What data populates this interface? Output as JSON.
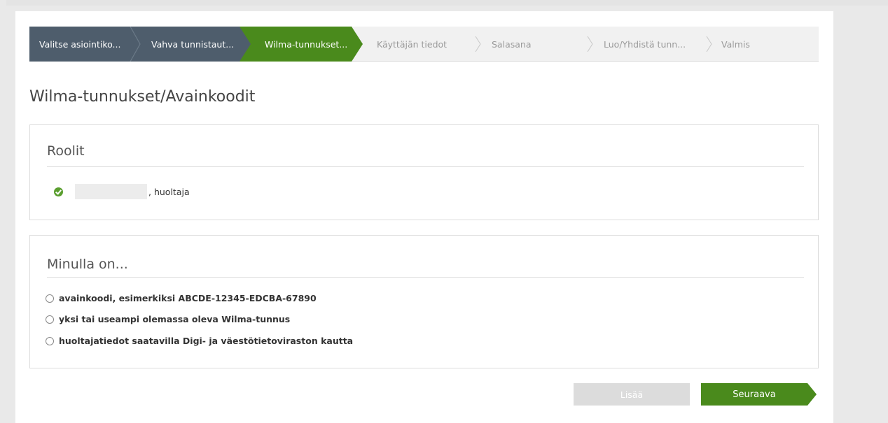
{
  "colors": {
    "step_done": "#4e5d6c",
    "step_active": "#4a8a1c",
    "primary_button": "#4a8a1c",
    "disabled_button": "#dcdcdc",
    "check_green": "#5a9e2f"
  },
  "stepper": {
    "steps": [
      {
        "label": "Valitse asiointiko...",
        "state": "done"
      },
      {
        "label": "Vahva tunnistaut...",
        "state": "done"
      },
      {
        "label": "Wilma-tunnukset...",
        "state": "active"
      },
      {
        "label": "Käyttäjän tiedot",
        "state": "todo"
      },
      {
        "label": "Salasana",
        "state": "todo"
      },
      {
        "label": "Luo/Yhdistä tunn...",
        "state": "todo"
      },
      {
        "label": "Valmis",
        "state": "todo"
      }
    ]
  },
  "page": {
    "title": "Wilma-tunnukset/Avainkoodit"
  },
  "roles_panel": {
    "title": "Roolit",
    "role_suffix": ", huoltaja",
    "role_icon": "check-circle-icon"
  },
  "options_panel": {
    "title": "Minulla on...",
    "options": [
      {
        "label": "avainkoodi, esimerkiksi ABCDE-12345-EDCBA-67890",
        "selected": false
      },
      {
        "label": "yksi tai useampi olemassa oleva Wilma-tunnus",
        "selected": false
      },
      {
        "label": "huoltajatiedot saatavilla Digi- ja väestötietoviraston kautta",
        "selected": false
      }
    ]
  },
  "buttons": {
    "add_label": "Lisää",
    "next_label": "Seuraava"
  }
}
